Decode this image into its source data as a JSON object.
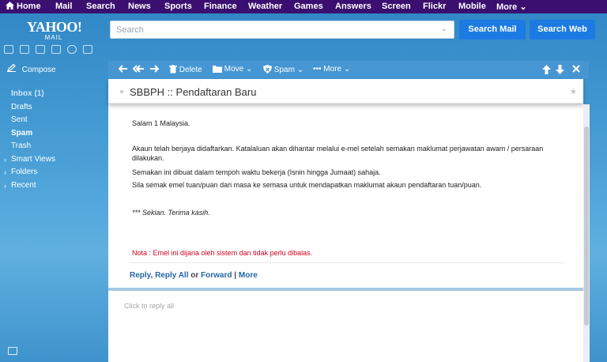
{
  "topnav": {
    "items": [
      "Home",
      "Mail",
      "Search",
      "News",
      "Sports",
      "Finance",
      "Weather",
      "Games",
      "Answers",
      "Screen",
      "Flickr",
      "Mobile",
      "More"
    ]
  },
  "logo": {
    "brand": "YAHOO!",
    "product": "MAIL"
  },
  "search": {
    "placeholder": "Search",
    "mail_button": "Search Mail",
    "web_button": "Search Web"
  },
  "sidebar": {
    "compose": "Compose",
    "folders": [
      {
        "label": "Inbox (1)"
      },
      {
        "label": "Drafts"
      },
      {
        "label": "Sent"
      },
      {
        "label": "Spam"
      },
      {
        "label": "Trash"
      },
      {
        "label": "Smart Views"
      },
      {
        "label": "Folders"
      },
      {
        "label": "Recent"
      }
    ]
  },
  "toolbar": {
    "delete": "Delete",
    "move": "Move",
    "spam": "Spam",
    "more": "More"
  },
  "email": {
    "subject": "SBBPH :: Pendaftaran Baru",
    "lines": [
      "Salam 1 Malaysia.",
      "Akaun telah berjaya didaftarkan. Katalaluan akan dihantar melalui e-mel setelah semakan maklumat perjawatan awam / persaraan",
      "dilakukan.",
      "Semakan ini dibuat dalam tempoh waktu bekerja (Isnin hingga Jumaat) sahaja.",
      "Sila semak emel tuan/puan dari masa ke semasa untuk mendapatkan maklumat akaun pendaftaran tuan/puan."
    ],
    "signoff": "*** Sekian. Terima kasih.",
    "note": "Nota : Emel ini dijana oleh sistem dan tidak perlu dibalas."
  },
  "reply": {
    "reply": "Reply",
    "comma": ",",
    "reply_all": "Reply All",
    "or": "or",
    "forward": "Forward",
    "pipe": "|",
    "more": "More",
    "placeholder": "Click to reply all"
  }
}
